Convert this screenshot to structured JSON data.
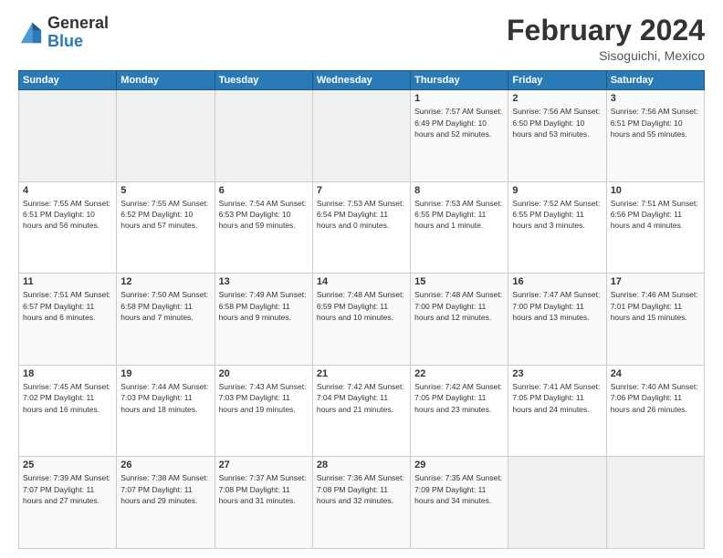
{
  "logo": {
    "line1": "General",
    "line2": "Blue"
  },
  "title": "February 2024",
  "subtitle": "Sisoguichi, Mexico",
  "weekdays": [
    "Sunday",
    "Monday",
    "Tuesday",
    "Wednesday",
    "Thursday",
    "Friday",
    "Saturday"
  ],
  "weeks": [
    [
      {
        "day": "",
        "detail": ""
      },
      {
        "day": "",
        "detail": ""
      },
      {
        "day": "",
        "detail": ""
      },
      {
        "day": "",
        "detail": ""
      },
      {
        "day": "1",
        "detail": "Sunrise: 7:57 AM\nSunset: 6:49 PM\nDaylight: 10 hours\nand 52 minutes."
      },
      {
        "day": "2",
        "detail": "Sunrise: 7:56 AM\nSunset: 6:50 PM\nDaylight: 10 hours\nand 53 minutes."
      },
      {
        "day": "3",
        "detail": "Sunrise: 7:56 AM\nSunset: 6:51 PM\nDaylight: 10 hours\nand 55 minutes."
      }
    ],
    [
      {
        "day": "4",
        "detail": "Sunrise: 7:55 AM\nSunset: 6:51 PM\nDaylight: 10 hours\nand 56 minutes."
      },
      {
        "day": "5",
        "detail": "Sunrise: 7:55 AM\nSunset: 6:52 PM\nDaylight: 10 hours\nand 57 minutes."
      },
      {
        "day": "6",
        "detail": "Sunrise: 7:54 AM\nSunset: 6:53 PM\nDaylight: 10 hours\nand 59 minutes."
      },
      {
        "day": "7",
        "detail": "Sunrise: 7:53 AM\nSunset: 6:54 PM\nDaylight: 11 hours\nand 0 minutes."
      },
      {
        "day": "8",
        "detail": "Sunrise: 7:53 AM\nSunset: 6:55 PM\nDaylight: 11 hours\nand 1 minute."
      },
      {
        "day": "9",
        "detail": "Sunrise: 7:52 AM\nSunset: 6:55 PM\nDaylight: 11 hours\nand 3 minutes."
      },
      {
        "day": "10",
        "detail": "Sunrise: 7:51 AM\nSunset: 6:56 PM\nDaylight: 11 hours\nand 4 minutes."
      }
    ],
    [
      {
        "day": "11",
        "detail": "Sunrise: 7:51 AM\nSunset: 6:57 PM\nDaylight: 11 hours\nand 6 minutes."
      },
      {
        "day": "12",
        "detail": "Sunrise: 7:50 AM\nSunset: 6:58 PM\nDaylight: 11 hours\nand 7 minutes."
      },
      {
        "day": "13",
        "detail": "Sunrise: 7:49 AM\nSunset: 6:58 PM\nDaylight: 11 hours\nand 9 minutes."
      },
      {
        "day": "14",
        "detail": "Sunrise: 7:48 AM\nSunset: 6:59 PM\nDaylight: 11 hours\nand 10 minutes."
      },
      {
        "day": "15",
        "detail": "Sunrise: 7:48 AM\nSunset: 7:00 PM\nDaylight: 11 hours\nand 12 minutes."
      },
      {
        "day": "16",
        "detail": "Sunrise: 7:47 AM\nSunset: 7:00 PM\nDaylight: 11 hours\nand 13 minutes."
      },
      {
        "day": "17",
        "detail": "Sunrise: 7:46 AM\nSunset: 7:01 PM\nDaylight: 11 hours\nand 15 minutes."
      }
    ],
    [
      {
        "day": "18",
        "detail": "Sunrise: 7:45 AM\nSunset: 7:02 PM\nDaylight: 11 hours\nand 16 minutes."
      },
      {
        "day": "19",
        "detail": "Sunrise: 7:44 AM\nSunset: 7:03 PM\nDaylight: 11 hours\nand 18 minutes."
      },
      {
        "day": "20",
        "detail": "Sunrise: 7:43 AM\nSunset: 7:03 PM\nDaylight: 11 hours\nand 19 minutes."
      },
      {
        "day": "21",
        "detail": "Sunrise: 7:42 AM\nSunset: 7:04 PM\nDaylight: 11 hours\nand 21 minutes."
      },
      {
        "day": "22",
        "detail": "Sunrise: 7:42 AM\nSunset: 7:05 PM\nDaylight: 11 hours\nand 23 minutes."
      },
      {
        "day": "23",
        "detail": "Sunrise: 7:41 AM\nSunset: 7:05 PM\nDaylight: 11 hours\nand 24 minutes."
      },
      {
        "day": "24",
        "detail": "Sunrise: 7:40 AM\nSunset: 7:06 PM\nDaylight: 11 hours\nand 26 minutes."
      }
    ],
    [
      {
        "day": "25",
        "detail": "Sunrise: 7:39 AM\nSunset: 7:07 PM\nDaylight: 11 hours\nand 27 minutes."
      },
      {
        "day": "26",
        "detail": "Sunrise: 7:38 AM\nSunset: 7:07 PM\nDaylight: 11 hours\nand 29 minutes."
      },
      {
        "day": "27",
        "detail": "Sunrise: 7:37 AM\nSunset: 7:08 PM\nDaylight: 11 hours\nand 31 minutes."
      },
      {
        "day": "28",
        "detail": "Sunrise: 7:36 AM\nSunset: 7:08 PM\nDaylight: 11 hours\nand 32 minutes."
      },
      {
        "day": "29",
        "detail": "Sunrise: 7:35 AM\nSunset: 7:09 PM\nDaylight: 11 hours\nand 34 minutes."
      },
      {
        "day": "",
        "detail": ""
      },
      {
        "day": "",
        "detail": ""
      }
    ]
  ]
}
